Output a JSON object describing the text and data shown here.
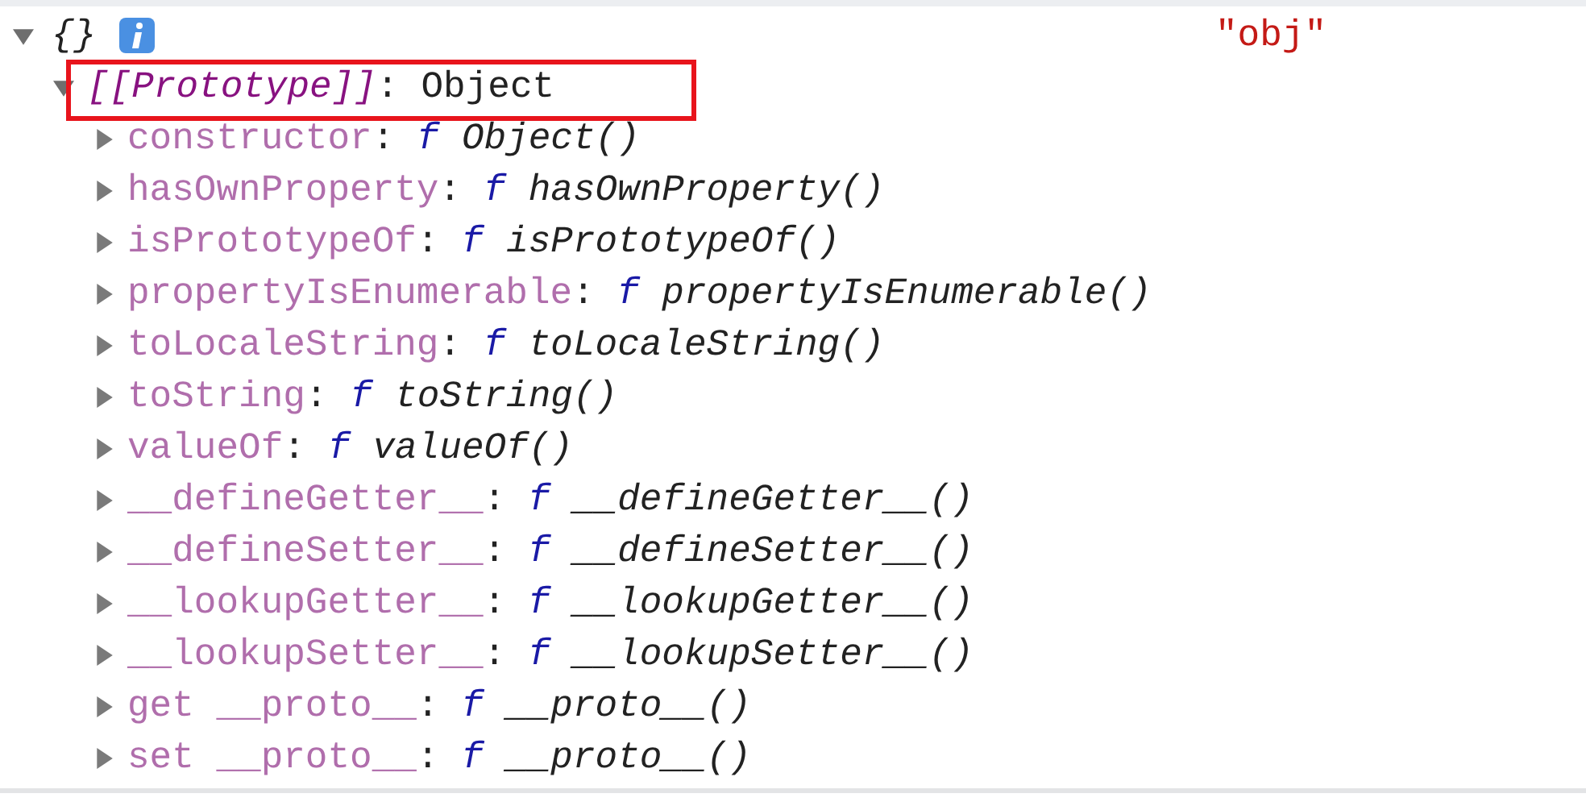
{
  "root": {
    "preview": "{}",
    "expanded": true,
    "label": "\"obj\""
  },
  "prototype": {
    "key": "[[Prototype]]",
    "separator": ":",
    "value": "Object",
    "expanded": true,
    "highlighted": true
  },
  "properties": [
    {
      "key": "constructor",
      "separator": ":",
      "prefix": "f",
      "value": "Object()",
      "expanded": false
    },
    {
      "key": "hasOwnProperty",
      "separator": ":",
      "prefix": "f",
      "value": "hasOwnProperty()",
      "expanded": false
    },
    {
      "key": "isPrototypeOf",
      "separator": ":",
      "prefix": "f",
      "value": "isPrototypeOf()",
      "expanded": false
    },
    {
      "key": "propertyIsEnumerable",
      "separator": ":",
      "prefix": "f",
      "value": "propertyIsEnumerable()",
      "expanded": false
    },
    {
      "key": "toLocaleString",
      "separator": ":",
      "prefix": "f",
      "value": "toLocaleString()",
      "expanded": false
    },
    {
      "key": "toString",
      "separator": ":",
      "prefix": "f",
      "value": "toString()",
      "expanded": false
    },
    {
      "key": "valueOf",
      "separator": ":",
      "prefix": "f",
      "value": "valueOf()",
      "expanded": false
    },
    {
      "key": "__defineGetter__",
      "separator": ":",
      "prefix": "f",
      "value": "__defineGetter__()",
      "expanded": false
    },
    {
      "key": "__defineSetter__",
      "separator": ":",
      "prefix": "f",
      "value": "__defineSetter__()",
      "expanded": false
    },
    {
      "key": "__lookupGetter__",
      "separator": ":",
      "prefix": "f",
      "value": "__lookupGetter__()",
      "expanded": false
    },
    {
      "key": "__lookupSetter__",
      "separator": ":",
      "prefix": "f",
      "value": "__lookupSetter__()",
      "expanded": false
    },
    {
      "key": "get __proto__",
      "separator": ":",
      "prefix": "f",
      "value": "__proto__()",
      "expanded": false
    },
    {
      "key": "set __proto__",
      "separator": ":",
      "prefix": "f",
      "value": "__proto__()",
      "expanded": false
    }
  ]
}
